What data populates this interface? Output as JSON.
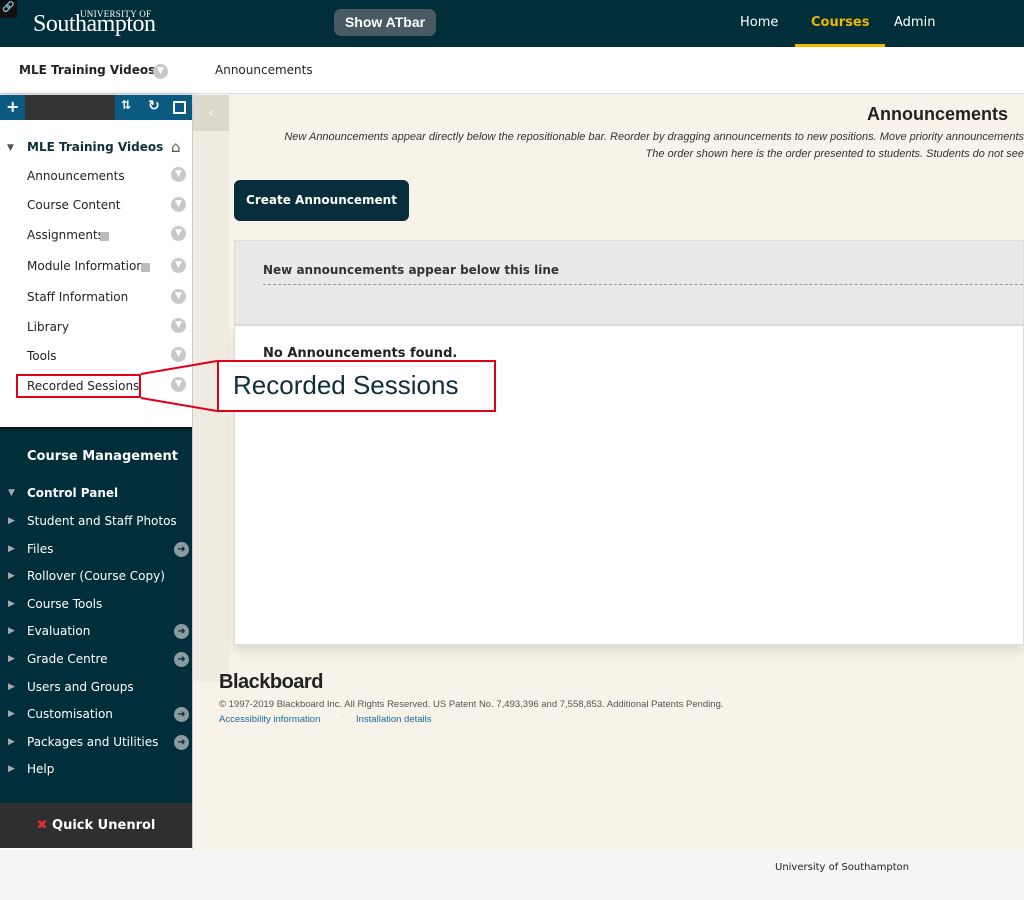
{
  "header": {
    "logo_top": "UNIVERSITY OF",
    "logo_name": "Southampton",
    "atbar": "Show ATbar",
    "nav": [
      "Home",
      "Courses",
      "Admin"
    ],
    "active_nav": "Courses",
    "accent": "#f2b500"
  },
  "breadcrumb": {
    "course": "MLE Training Videos",
    "page": "Announcements"
  },
  "sidebar": {
    "course_title": "MLE Training Videos",
    "items": [
      "Announcements",
      "Course Content",
      "Assignments",
      "Module Information",
      "Staff Information",
      "Library",
      "Tools",
      "Recorded Sessions"
    ],
    "management_title": "Course Management",
    "control_panel": "Control Panel",
    "cp_items": [
      "Student and Staff Photos",
      "Files",
      "Rollover (Course Copy)",
      "Course Tools",
      "Evaluation",
      "Grade Centre",
      "Users and Groups",
      "Customisation",
      "Packages and Utilities",
      "Help"
    ],
    "quick_unenrol": "Quick Unenrol"
  },
  "main": {
    "title": "Announcements",
    "instr1": "New Announcements appear directly below the repositionable bar. Reorder by dragging announcements to new positions. Move priority announcements",
    "instr2": "The order shown here is the order presented to students. Students do not see",
    "create": "Create Announcement",
    "bar_text": "New announcements appear below this line",
    "empty": "No Announcements found."
  },
  "callout": {
    "text": "Recorded Sessions"
  },
  "footer": {
    "brand": "Blackboard",
    "copyright": "© 1997-2019 Blackboard Inc. All Rights Reserved. US Patent No. 7,493,396 and 7,558,853. Additional Patents Pending.",
    "link1": "Accessibility information",
    "link2": "Installation details",
    "institution": "University of Southampton"
  }
}
